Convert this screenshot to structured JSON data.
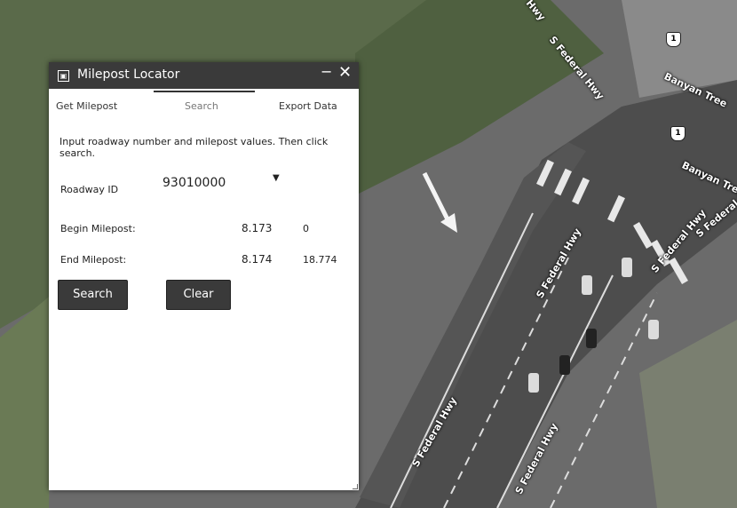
{
  "map": {
    "road_labels": [
      "S Federal Hwy",
      "S Federal Hwy",
      "S Federal Hwy",
      "S Federal Hwy",
      "S Federal Hwy",
      "S Federal Hwy",
      "Banyan Tree",
      "Banyan Tree"
    ],
    "shield_labels": [
      "1",
      "1"
    ],
    "partial_label": "Hwy"
  },
  "window": {
    "title": "Milepost Locator",
    "minimize_glyph": "−",
    "close_glyph": "✕"
  },
  "tabs": [
    {
      "label": "Get Milepost"
    },
    {
      "label": "Search"
    },
    {
      "label": "Export Data"
    }
  ],
  "active_tab": "Search",
  "form": {
    "instructions": "Input roadway number and milepost values. Then click search.",
    "roadway_label": "Roadway ID",
    "roadway_value": "93010000",
    "begin_label": "Begin Milepost:",
    "begin_value": "8.173",
    "begin_min": "0",
    "end_label": "End Milepost:",
    "end_value": "8.174",
    "end_max": "18.774"
  },
  "buttons": {
    "search": "Search",
    "clear": "Clear"
  },
  "colors": {
    "panel_header": "#3a3a3a",
    "button_bg": "#3a3a3a"
  }
}
